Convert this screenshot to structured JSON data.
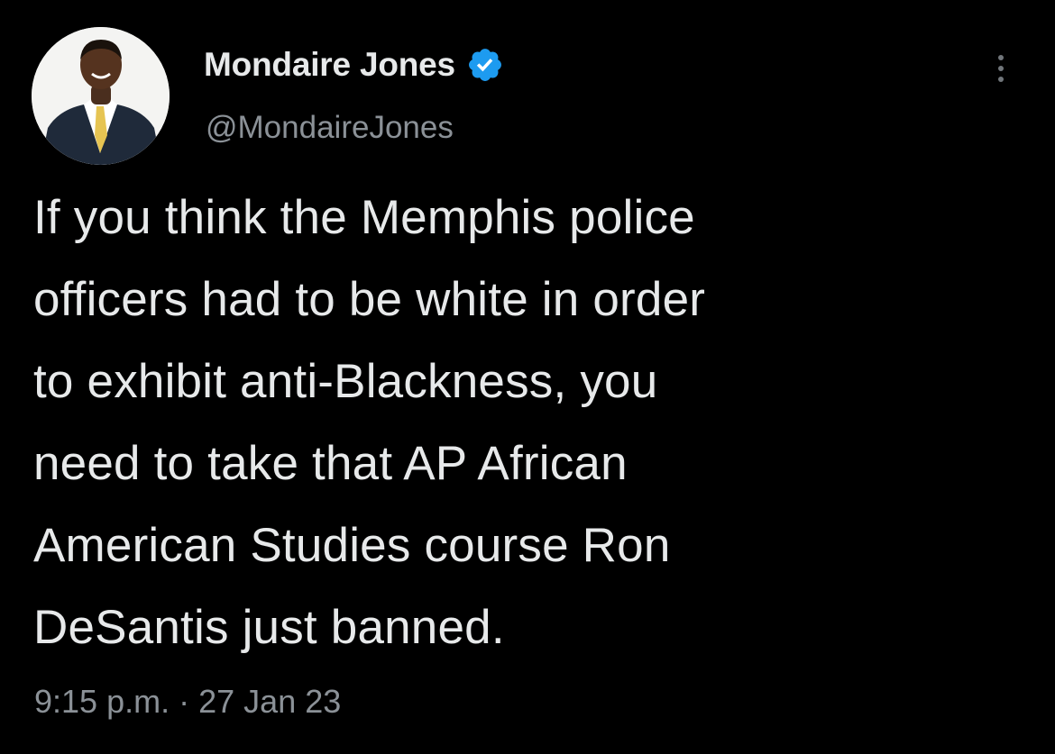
{
  "author": {
    "display_name": "Mondaire Jones",
    "handle": "@MondaireJones",
    "verified": true,
    "avatar_icon": "profile-photo"
  },
  "tweet": {
    "text_lines": [
      "If you think the Memphis police",
      "officers had to be white in order",
      "to exhibit anti-Blackness, you",
      "need to take that AP African",
      "American Studies course Ron",
      "DeSantis just banned."
    ],
    "time": "9:15 p.m.",
    "separator": "·",
    "date": "27 Jan 23"
  },
  "icons": {
    "verified": "verified-badge-icon",
    "more": "more-options-icon"
  },
  "colors": {
    "background": "#000000",
    "primary_text": "#e7e9ea",
    "secondary_text": "#8b9197",
    "verified_blue": "#1d9bf0"
  }
}
